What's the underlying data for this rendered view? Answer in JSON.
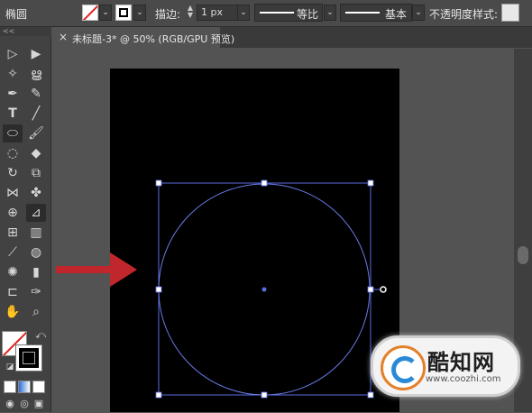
{
  "control_bar": {
    "tool_name": "椭圆",
    "stroke_label": "描边:",
    "stroke_weight": "1 px",
    "profile_label": "等比",
    "brush_label": "基本",
    "opacity_label": "不透明度",
    "style_label": "样式:"
  },
  "document_tab": {
    "title": "未标题-3* @ 50% (RGB/GPU 预览)",
    "close_glyph": "×"
  },
  "toolbar": {
    "collapse_glyph": "<<",
    "active_tool": "ellipse-tool"
  },
  "colors": {
    "background": "#535353",
    "artboard": "#000000",
    "selection": "#5a6de0",
    "arrow": "#c0272d"
  },
  "watermark": {
    "title": "酷知网",
    "url": "www.coozhi.com"
  }
}
